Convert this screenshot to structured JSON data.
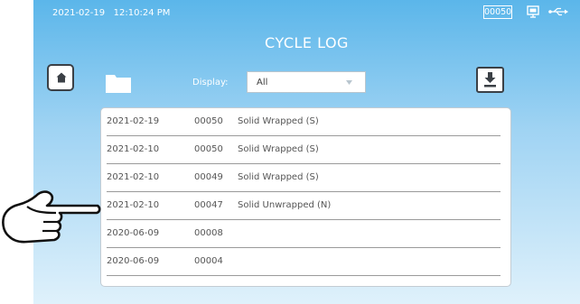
{
  "status_bar": {
    "date": "2021-02-19",
    "time": "12:10:24 PM",
    "cycle_counter": "00050",
    "icons": [
      "screen-icon",
      "usb-icon"
    ]
  },
  "page": {
    "title": "CYCLE LOG"
  },
  "toolbar": {
    "home_icon": "home-icon",
    "folder_icon": "folder-icon",
    "display_label": "Display:",
    "display_value": "All",
    "download_icon": "download-icon"
  },
  "cycle_log": [
    {
      "date": "2021-02-19",
      "cycle": "00050",
      "type": "Solid Wrapped (S)"
    },
    {
      "date": "2021-02-10",
      "cycle": "00050",
      "type": "Solid Wrapped (S)"
    },
    {
      "date": "2021-02-10",
      "cycle": "00049",
      "type": "Solid Wrapped (S)"
    },
    {
      "date": "2021-02-10",
      "cycle": "00047",
      "type": "Solid Unwrapped (N)"
    },
    {
      "date": "2020-06-09",
      "cycle": "00008",
      "type": ""
    },
    {
      "date": "2020-06-09",
      "cycle": "00004",
      "type": ""
    }
  ],
  "overlay": {
    "pointer_icon": "hand-pointer-icon",
    "pointing_at_row": 4
  },
  "colors": {
    "background_top": "#5bb6ea",
    "background_bottom": "#dff1fb",
    "text_white": "#ffffff",
    "row_text": "#555555"
  }
}
